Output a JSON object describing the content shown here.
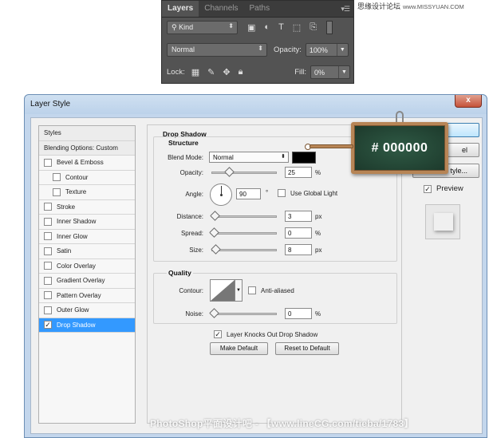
{
  "watermark_top": {
    "site": "思缘设计论坛",
    "domain": "www.MISSYUAN.COM"
  },
  "layers_panel": {
    "tabs": [
      "Layers",
      "Channels",
      "Paths"
    ],
    "filter_kind": "Kind",
    "blend_mode": "Normal",
    "opacity_label": "Opacity:",
    "opacity_value": "100%",
    "lock_label": "Lock:",
    "fill_label": "Fill:",
    "fill_value": "0%"
  },
  "dialog": {
    "title": "Layer Style",
    "close": "x",
    "styles_list": [
      {
        "label": "Styles",
        "type": "header"
      },
      {
        "label": "Blending Options: Custom",
        "type": "header"
      },
      {
        "label": "Bevel & Emboss",
        "checked": false
      },
      {
        "label": "Contour",
        "checked": false,
        "indent": true
      },
      {
        "label": "Texture",
        "checked": false,
        "indent": true
      },
      {
        "label": "Stroke",
        "checked": false
      },
      {
        "label": "Inner Shadow",
        "checked": false
      },
      {
        "label": "Inner Glow",
        "checked": false
      },
      {
        "label": "Satin",
        "checked": false
      },
      {
        "label": "Color Overlay",
        "checked": false
      },
      {
        "label": "Gradient Overlay",
        "checked": false
      },
      {
        "label": "Pattern Overlay",
        "checked": false
      },
      {
        "label": "Outer Glow",
        "checked": false
      },
      {
        "label": "Drop Shadow",
        "checked": true,
        "selected": true
      }
    ],
    "drop_shadow": {
      "title": "Drop Shadow",
      "structure_title": "Structure",
      "blend_mode_label": "Blend Mode:",
      "blend_mode_value": "Normal",
      "color": "#000000",
      "opacity_label": "Opacity:",
      "opacity_value": "25",
      "opacity_pct": 25,
      "angle_label": "Angle:",
      "angle_value": "90",
      "angle_unit": "°",
      "use_global_light": "Use Global Light",
      "distance_label": "Distance:",
      "distance_value": "3",
      "spread_label": "Spread:",
      "spread_value": "0",
      "size_label": "Size:",
      "size_value": "8",
      "unit_px": "px",
      "unit_pct": "%",
      "quality_title": "Quality",
      "contour_label": "Contour:",
      "anti_aliased": "Anti-aliased",
      "noise_label": "Noise:",
      "noise_value": "0",
      "layer_knocks_out": "Layer Knocks Out Drop Shadow",
      "make_default": "Make Default",
      "reset_default": "Reset to Default"
    },
    "right": {
      "cancel_partial": "el",
      "new_style_partial": "tyle...",
      "preview_label": "Preview"
    },
    "callout": {
      "text": "# 000000"
    }
  },
  "watermark_bottom": "PhotoShop平面设计吧 - 【www.lineCG.com/tieba/1783】"
}
